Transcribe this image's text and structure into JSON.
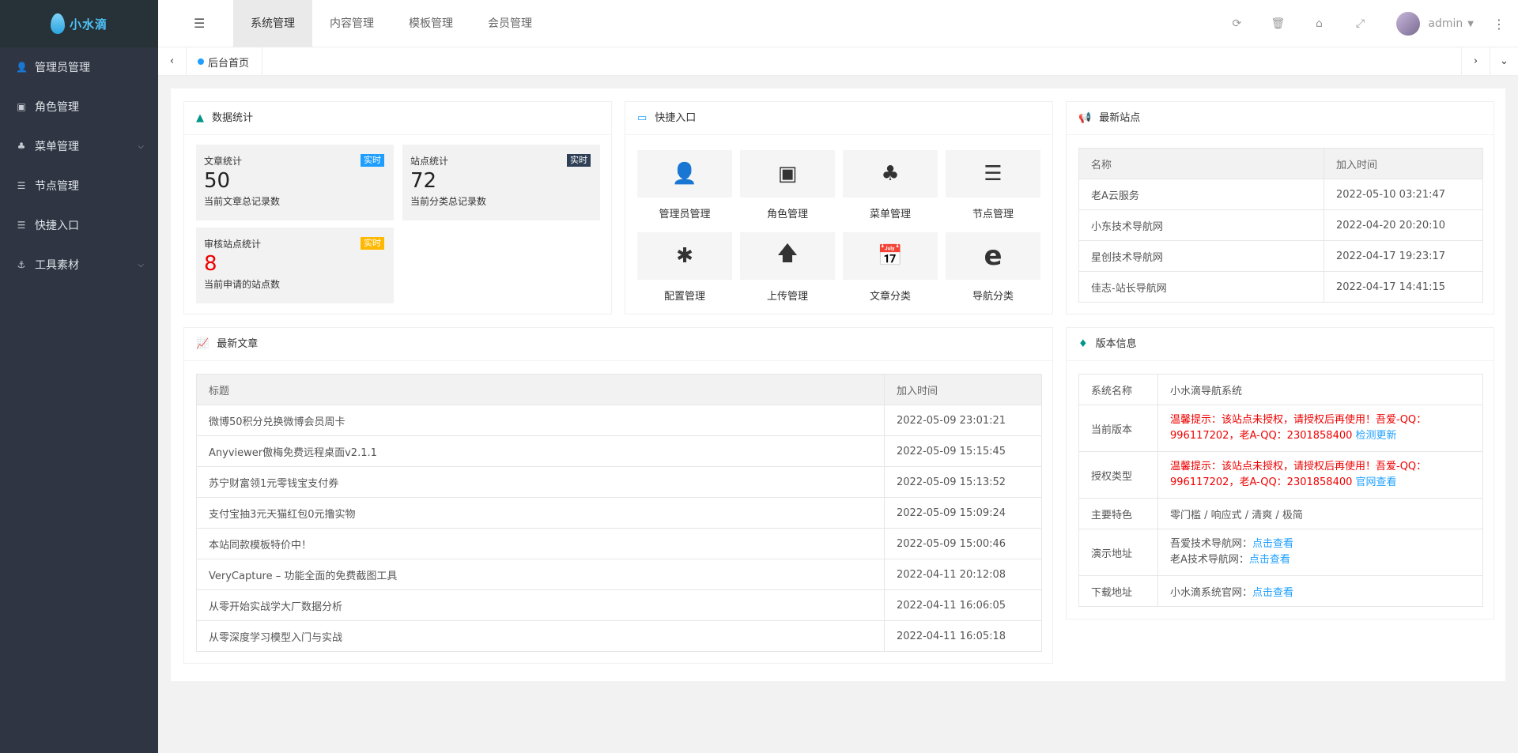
{
  "logo": {
    "text": "小水滴"
  },
  "sidebar": {
    "items": [
      {
        "icon": "user-icon",
        "glyph": "👤",
        "label": "管理员管理",
        "arrow": false
      },
      {
        "icon": "role-icon",
        "glyph": "▣",
        "label": "角色管理",
        "arrow": false
      },
      {
        "icon": "tree-icon",
        "glyph": "♣",
        "label": "菜单管理",
        "arrow": true
      },
      {
        "icon": "list-icon",
        "glyph": "☰",
        "label": "节点管理",
        "arrow": false
      },
      {
        "icon": "list-icon",
        "glyph": "☰",
        "label": "快捷入口",
        "arrow": false
      },
      {
        "icon": "anchor-icon",
        "glyph": "⚓",
        "label": "工具素材",
        "arrow": true
      }
    ]
  },
  "header": {
    "tabs": [
      "系统管理",
      "内容管理",
      "模板管理",
      "会员管理"
    ],
    "user": "admin"
  },
  "tabbar": {
    "home": "后台首页"
  },
  "stats": {
    "title": "数据统计",
    "items": [
      {
        "title": "文章统计",
        "badge": "实时",
        "badge_color": "#1e9fff",
        "num": "50",
        "desc": "当前文章总记录数",
        "num_color": "#222"
      },
      {
        "title": "站点统计",
        "badge": "实时",
        "badge_color": "#2f4056",
        "num": "72",
        "desc": "当前分类总记录数",
        "num_color": "#222"
      },
      {
        "title": "审核站点统计",
        "badge": "实时",
        "badge_color": "#ffb800",
        "num": "8",
        "desc": "当前申请的站点数",
        "num_color": "#e00"
      }
    ]
  },
  "quick": {
    "title": "快捷入口",
    "items": [
      {
        "icon": "user-icon",
        "glyph": "👤",
        "label": "管理员管理"
      },
      {
        "icon": "role-icon",
        "glyph": "▣",
        "label": "角色管理"
      },
      {
        "icon": "tree-icon",
        "glyph": "♣",
        "label": "菜单管理"
      },
      {
        "icon": "list-icon",
        "glyph": "☰",
        "label": "节点管理"
      },
      {
        "icon": "asterisk-icon",
        "glyph": "✱",
        "label": "配置管理"
      },
      {
        "icon": "upload-icon",
        "glyph": "🡅",
        "label": "上传管理"
      },
      {
        "icon": "calendar-icon",
        "glyph": "📅",
        "label": "文章分类"
      },
      {
        "icon": "edge-icon",
        "glyph": "e",
        "label": "导航分类"
      }
    ]
  },
  "sites": {
    "title": "最新站点",
    "headers": [
      "名称",
      "加入时间"
    ],
    "rows": [
      [
        "老A云服务",
        "2022-05-10 03:21:47"
      ],
      [
        "小东技术导航网",
        "2022-04-20 20:20:10"
      ],
      [
        "星创技术导航网",
        "2022-04-17 19:23:17"
      ],
      [
        "佳志-站长导航网",
        "2022-04-17 14:41:15"
      ]
    ]
  },
  "articles": {
    "title": "最新文章",
    "headers": [
      "标题",
      "加入时间"
    ],
    "rows": [
      [
        "微博50积分兑换微博会员周卡",
        "2022-05-09 23:01:21"
      ],
      [
        "Anyviewer傲梅免费远程桌面v2.1.1",
        "2022-05-09 15:15:45"
      ],
      [
        "苏宁财富领1元零钱宝支付券",
        "2022-05-09 15:13:52"
      ],
      [
        "支付宝抽3元天猫红包0元撸实物",
        "2022-05-09 15:09:24"
      ],
      [
        "本站同款模板特价中！",
        "2022-05-09 15:00:46"
      ],
      [
        "VeryCapture – 功能全面的免费截图工具",
        "2022-04-11 20:12:08"
      ],
      [
        "从零开始实战学大厂数据分析",
        "2022-04-11 16:06:05"
      ],
      [
        "从零深度学习模型入门与实战",
        "2022-04-11 16:05:18"
      ]
    ]
  },
  "version": {
    "title": "版本信息",
    "name_label": "系统名称",
    "name_value": "小水滴导航系统",
    "cur_label": "当前版本",
    "warn_line1": "温馨提示：该站点未授权，请授权后再使用！吾爱-QQ：",
    "warn_line2": "996117202，老A-QQ：2301858400",
    "cur_link": "检测更新",
    "auth_label": "授权类型",
    "auth_link": "官网查看",
    "feat_label": "主要特色",
    "feat_value": "零门槛 / 响应式 / 清爽 / 极简",
    "demo_label": "演示地址",
    "demo1_prefix": "吾爱技术导航网：",
    "demo1_link": "点击查看",
    "demo2_prefix": "老A技术导航网：",
    "demo2_link": "点击查看",
    "dl_label": "下载地址",
    "dl_prefix": "小水滴系统官网：",
    "dl_link": "点击查看"
  }
}
